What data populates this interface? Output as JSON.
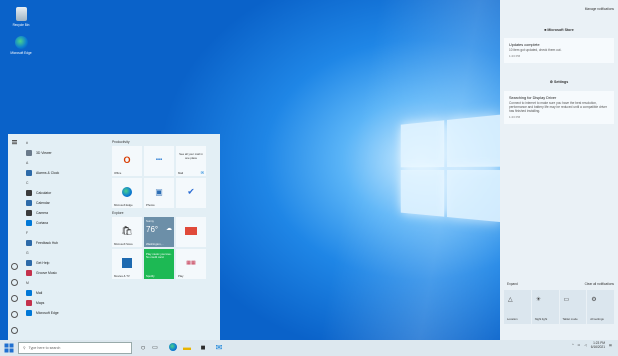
{
  "colors": {
    "accent": "#0078d7",
    "office": "#d83b01",
    "spotify": "#1db954",
    "store_tile": "#2b2b2b",
    "weather": "#6c8fa8"
  },
  "desktop": {
    "icons": [
      {
        "label": "Recycle Bin",
        "icon": "recycle-bin-icon"
      },
      {
        "label": "Microsoft Edge",
        "icon": "edge-icon"
      }
    ]
  },
  "start_menu": {
    "app_list": [
      {
        "type": "letter",
        "text": "#"
      },
      {
        "type": "app",
        "text": "3D Viewer",
        "color": "#6a7a8a"
      },
      {
        "type": "letter",
        "text": "A"
      },
      {
        "type": "app",
        "text": "Alarms & Clock",
        "color": "#2d6aa8"
      },
      {
        "type": "letter",
        "text": "C"
      },
      {
        "type": "app",
        "text": "Calculator",
        "color": "#3a3a3a"
      },
      {
        "type": "app",
        "text": "Calendar",
        "color": "#2d6aa8"
      },
      {
        "type": "app",
        "text": "Camera",
        "color": "#3a3a3a"
      },
      {
        "type": "app",
        "text": "Cortana",
        "color": "#0078d7"
      },
      {
        "type": "letter",
        "text": "F"
      },
      {
        "type": "app",
        "text": "Feedback Hub",
        "color": "#2d6aa8"
      },
      {
        "type": "letter",
        "text": "G"
      },
      {
        "type": "app",
        "text": "Get Help",
        "color": "#2d6aa8"
      },
      {
        "type": "app",
        "text": "Groove Music",
        "color": "#c4314b"
      },
      {
        "type": "letter",
        "text": "M"
      },
      {
        "type": "app",
        "text": "Mail",
        "color": "#0078d7"
      },
      {
        "type": "app",
        "text": "Maps",
        "color": "#c4314b"
      },
      {
        "type": "app",
        "text": "Microsoft Edge",
        "color": "#0078d7"
      }
    ],
    "groups": {
      "productivity": "Productivity",
      "explore": "Explore"
    },
    "tiles": {
      "office": "Office",
      "see_all": "See all your mail in one place",
      "mail": "Mail",
      "edge": "Microsoft Edge",
      "photos": "Photos",
      "store": "Microsoft Store",
      "weather_label": "Sunny",
      "weather_temp": "76°",
      "weather_city": "Washington,...",
      "spotify_text": "Play music you love. No credit card.",
      "spotify": "Spotify",
      "news": "Movies & TV",
      "play": "Play"
    }
  },
  "action_center": {
    "manage": "Manage notifications",
    "groups": [
      {
        "app": "Microsoft Store",
        "title": "Updates complete",
        "body": "10 item got updated, check them out.",
        "time": "1:23 PM"
      },
      {
        "app": "Settings",
        "title": "Searching for Display Driver",
        "body": "Connect to internet to make sure you have the best resolution, performance and battery life may be reduced until a compatible driver has finished installing.",
        "time": "1:23 PM"
      }
    ],
    "expand": "Expand",
    "see_all": "Clear all notifications",
    "quick_actions": [
      {
        "label": "Location",
        "icon": "location-icon"
      },
      {
        "label": "Night light",
        "icon": "night-light-icon"
      },
      {
        "label": "Tablet mode",
        "icon": "tablet-icon"
      },
      {
        "label": "All settings",
        "icon": "gear-icon"
      }
    ]
  },
  "taskbar": {
    "search_placeholder": "Type here to search",
    "time": "1:23 PM",
    "date": "6/16/2021"
  }
}
